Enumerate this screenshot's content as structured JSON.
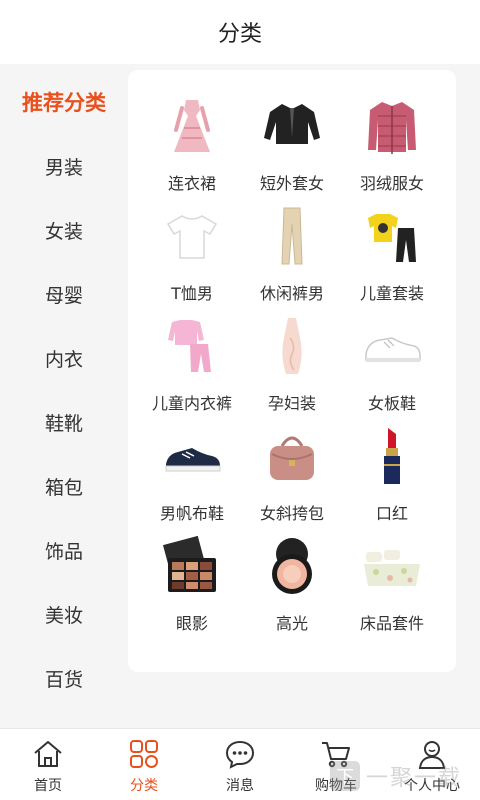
{
  "header": {
    "title": "分类"
  },
  "sidebar": {
    "items": [
      {
        "label": "推荐分类",
        "active": true
      },
      {
        "label": "男装"
      },
      {
        "label": "女装"
      },
      {
        "label": "母婴"
      },
      {
        "label": "内衣"
      },
      {
        "label": "鞋靴"
      },
      {
        "label": "箱包"
      },
      {
        "label": "饰品"
      },
      {
        "label": "美妆"
      },
      {
        "label": "百货"
      }
    ]
  },
  "grid": {
    "items": [
      {
        "label": "连衣裙",
        "icon": "dress-icon"
      },
      {
        "label": "短外套女",
        "icon": "cardigan-icon"
      },
      {
        "label": "羽绒服女",
        "icon": "down-jacket-icon"
      },
      {
        "label": "T恤男",
        "icon": "tshirt-icon"
      },
      {
        "label": "休闲裤男",
        "icon": "trousers-icon"
      },
      {
        "label": "儿童套装",
        "icon": "kids-set-icon"
      },
      {
        "label": "儿童内衣裤",
        "icon": "kids-underwear-icon"
      },
      {
        "label": "孕妇装",
        "icon": "maternity-dress-icon"
      },
      {
        "label": "女板鞋",
        "icon": "sneaker-icon"
      },
      {
        "label": "男帆布鞋",
        "icon": "canvas-shoe-icon"
      },
      {
        "label": "女斜挎包",
        "icon": "crossbody-bag-icon"
      },
      {
        "label": "口红",
        "icon": "lipstick-icon"
      },
      {
        "label": "眼影",
        "icon": "eyeshadow-icon"
      },
      {
        "label": "高光",
        "icon": "highlighter-icon"
      },
      {
        "label": "床品套件",
        "icon": "bedding-icon"
      }
    ]
  },
  "tabbar": {
    "items": [
      {
        "label": "首页",
        "icon": "home-icon"
      },
      {
        "label": "分类",
        "icon": "category-icon",
        "active": true
      },
      {
        "label": "消息",
        "icon": "message-icon"
      },
      {
        "label": "购物车",
        "icon": "cart-icon"
      },
      {
        "label": "个人中心",
        "icon": "profile-icon"
      }
    ]
  },
  "watermark": {
    "box_text": "下",
    "text": "一聚一载"
  },
  "colors": {
    "accent": "#e8511d",
    "text": "#333333",
    "background": "#f5f5f5",
    "panel": "#ffffff"
  }
}
